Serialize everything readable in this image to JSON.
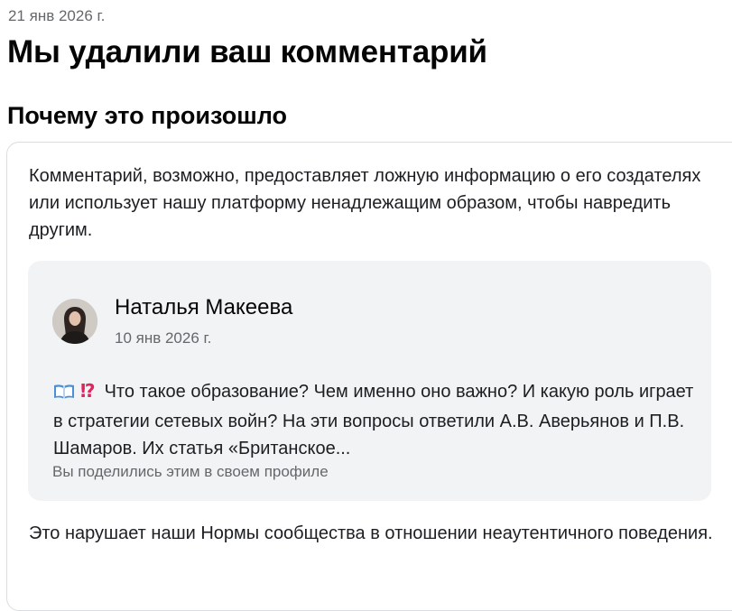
{
  "header": {
    "date": "21 янв 2026 г.",
    "title": "Мы удалили ваш комментарий"
  },
  "section": {
    "heading": "Почему это произошло",
    "reason": "Комментарий, возможно, предоставляет ложную информацию о его создателях или использует нашу платформу ненадлежащим образом, чтобы навредить другим."
  },
  "comment": {
    "author": "Наталья Макеева",
    "date": "10 янв 2026 г.",
    "emoji_icons": [
      "open-book-icon",
      "exclamation-question-icon"
    ],
    "emoji_book": "📖",
    "emoji_interrobang": "⁉",
    "text": "Что такое образование? Чем именно оно важно? И какую роль играет в стратегии сетевых войн? На эти вопросы ответили А.В. Аверьянов и П.В. Шамаров. Их статья «Британское...",
    "shared_note": "Вы поделились этим в своем профиле"
  },
  "footer": {
    "text": "Это нарушает наши Нормы сообщества в отношении неаутентичного поведения."
  },
  "colors": {
    "text": "#1c1e21",
    "muted": "#65676b",
    "quote_bg": "#f2f3f5",
    "border": "#dadde1",
    "interrobang": "#e0245e"
  }
}
